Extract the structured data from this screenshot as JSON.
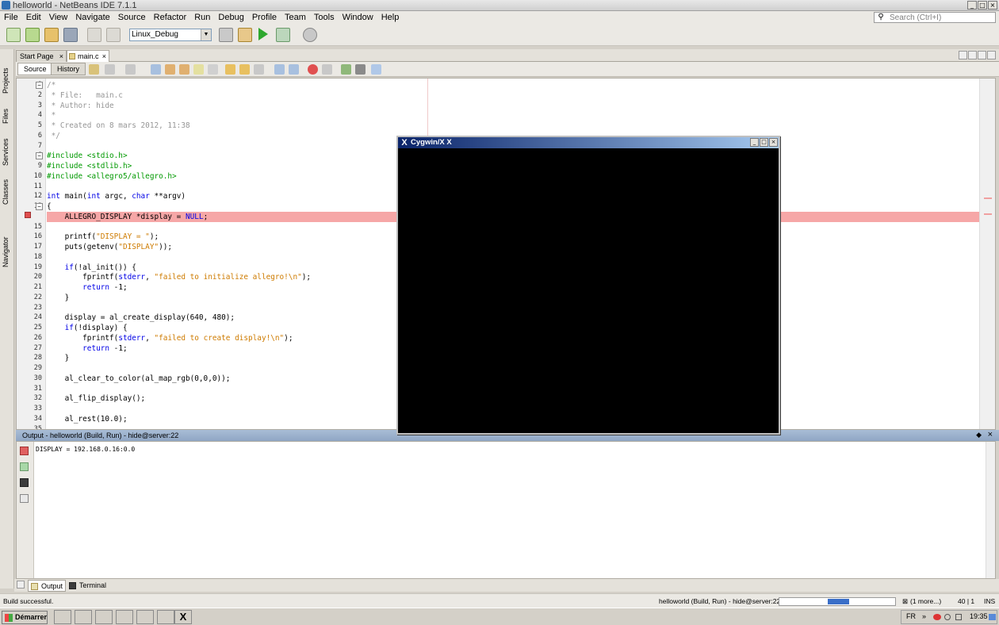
{
  "window": {
    "title": "helloworld - NetBeans IDE 7.1.1",
    "min": "_",
    "max": "□",
    "close": "×"
  },
  "menu": [
    "File",
    "Edit",
    "View",
    "Navigate",
    "Source",
    "Refactor",
    "Run",
    "Debug",
    "Profile",
    "Team",
    "Tools",
    "Window",
    "Help"
  ],
  "search": {
    "placeholder": "Search (Ctrl+I)"
  },
  "toolbar": {
    "config_value": "Linux_Debug"
  },
  "side_tabs": [
    "Projects",
    "Files",
    "Services",
    "Classes",
    "Navigator"
  ],
  "editor_tabs": [
    {
      "label": "Start Page",
      "close": "×"
    },
    {
      "label": "main.c",
      "close": "×"
    }
  ],
  "source_tabs": {
    "source": "Source",
    "history": "History"
  },
  "code": {
    "line_numbers": [
      "1",
      "2",
      "3",
      "4",
      "5",
      "6",
      "7",
      "8",
      "9",
      "10",
      "11",
      "12",
      "13",
      "",
      "15",
      "16",
      "17",
      "18",
      "19",
      "20",
      "21",
      "22",
      "23",
      "24",
      "25",
      "26",
      "27",
      "28",
      "29",
      "30",
      "31",
      "32",
      "33",
      "34",
      "35"
    ],
    "lines": [
      "/*",
      " * File:   main.c",
      " * Author: hide",
      " *",
      " * Created on 8 mars 2012, 11:38",
      " */",
      "",
      "#include <stdio.h>",
      "#include <stdlib.h>",
      "#include <allegro5/allegro.h>",
      "",
      "int main(int argc, char **argv)",
      "{",
      "    ALLEGRO_DISPLAY *display = NULL;",
      "",
      "    printf(\"DISPLAY = \");",
      "    puts(getenv(\"DISPLAY\"));",
      "",
      "    if(!al_init()) {",
      "        fprintf(stderr, \"failed to initialize allegro!\\n\");",
      "        return -1;",
      "    }",
      "",
      "    display = al_create_display(640, 480);",
      "    if(!display) {",
      "        fprintf(stderr, \"failed to create display!\\n\");",
      "        return -1;",
      "    }",
      "",
      "    al_clear_to_color(al_map_rgb(0,0,0));",
      "",
      "    al_flip_display();",
      "",
      "    al_rest(10.0);",
      ""
    ]
  },
  "output": {
    "header": "Output - helloworld (Build, Run) - hide@server:22",
    "text": "DISPLAY = 192.168.0.16:0.0"
  },
  "bottom_tabs": {
    "output": "Output",
    "terminal": "Terminal"
  },
  "status": {
    "left": "Build successful.",
    "task": "helloworld (Build, Run) - hide@server:22",
    "more": "(1 more...)",
    "position": "40 | 1",
    "mode": "INS"
  },
  "xwindow": {
    "title": "Cygwin/X X",
    "icon": "X"
  },
  "taskbar": {
    "start": "Démarrer",
    "lang": "FR",
    "time": "19:35"
  },
  "colors": {
    "breakpoint_line": "#f6a7a7",
    "keyword": "#0000e6",
    "string": "#ce7b00",
    "comment": "#969696",
    "preprocessor": "#009900"
  }
}
